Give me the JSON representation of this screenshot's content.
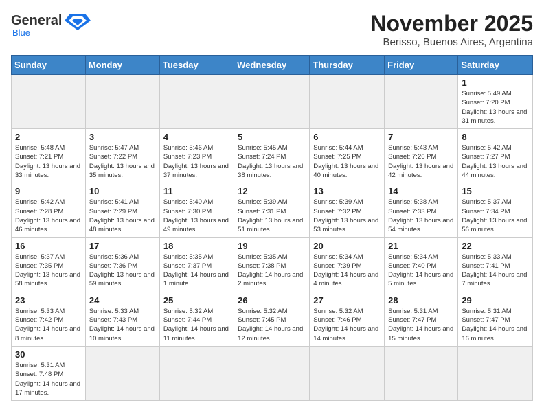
{
  "header": {
    "logo_general": "General",
    "logo_blue": "Blue",
    "month_title": "November 2025",
    "location": "Berisso, Buenos Aires, Argentina"
  },
  "weekdays": [
    "Sunday",
    "Monday",
    "Tuesday",
    "Wednesday",
    "Thursday",
    "Friday",
    "Saturday"
  ],
  "weeks": [
    [
      {
        "day": "",
        "info": ""
      },
      {
        "day": "",
        "info": ""
      },
      {
        "day": "",
        "info": ""
      },
      {
        "day": "",
        "info": ""
      },
      {
        "day": "",
        "info": ""
      },
      {
        "day": "",
        "info": ""
      },
      {
        "day": "1",
        "info": "Sunrise: 5:49 AM\nSunset: 7:20 PM\nDaylight: 13 hours and 31 minutes."
      }
    ],
    [
      {
        "day": "2",
        "info": "Sunrise: 5:48 AM\nSunset: 7:21 PM\nDaylight: 13 hours and 33 minutes."
      },
      {
        "day": "3",
        "info": "Sunrise: 5:47 AM\nSunset: 7:22 PM\nDaylight: 13 hours and 35 minutes."
      },
      {
        "day": "4",
        "info": "Sunrise: 5:46 AM\nSunset: 7:23 PM\nDaylight: 13 hours and 37 minutes."
      },
      {
        "day": "5",
        "info": "Sunrise: 5:45 AM\nSunset: 7:24 PM\nDaylight: 13 hours and 38 minutes."
      },
      {
        "day": "6",
        "info": "Sunrise: 5:44 AM\nSunset: 7:25 PM\nDaylight: 13 hours and 40 minutes."
      },
      {
        "day": "7",
        "info": "Sunrise: 5:43 AM\nSunset: 7:26 PM\nDaylight: 13 hours and 42 minutes."
      },
      {
        "day": "8",
        "info": "Sunrise: 5:42 AM\nSunset: 7:27 PM\nDaylight: 13 hours and 44 minutes."
      }
    ],
    [
      {
        "day": "9",
        "info": "Sunrise: 5:42 AM\nSunset: 7:28 PM\nDaylight: 13 hours and 46 minutes."
      },
      {
        "day": "10",
        "info": "Sunrise: 5:41 AM\nSunset: 7:29 PM\nDaylight: 13 hours and 48 minutes."
      },
      {
        "day": "11",
        "info": "Sunrise: 5:40 AM\nSunset: 7:30 PM\nDaylight: 13 hours and 49 minutes."
      },
      {
        "day": "12",
        "info": "Sunrise: 5:39 AM\nSunset: 7:31 PM\nDaylight: 13 hours and 51 minutes."
      },
      {
        "day": "13",
        "info": "Sunrise: 5:39 AM\nSunset: 7:32 PM\nDaylight: 13 hours and 53 minutes."
      },
      {
        "day": "14",
        "info": "Sunrise: 5:38 AM\nSunset: 7:33 PM\nDaylight: 13 hours and 54 minutes."
      },
      {
        "day": "15",
        "info": "Sunrise: 5:37 AM\nSunset: 7:34 PM\nDaylight: 13 hours and 56 minutes."
      }
    ],
    [
      {
        "day": "16",
        "info": "Sunrise: 5:37 AM\nSunset: 7:35 PM\nDaylight: 13 hours and 58 minutes."
      },
      {
        "day": "17",
        "info": "Sunrise: 5:36 AM\nSunset: 7:36 PM\nDaylight: 13 hours and 59 minutes."
      },
      {
        "day": "18",
        "info": "Sunrise: 5:35 AM\nSunset: 7:37 PM\nDaylight: 14 hours and 1 minute."
      },
      {
        "day": "19",
        "info": "Sunrise: 5:35 AM\nSunset: 7:38 PM\nDaylight: 14 hours and 2 minutes."
      },
      {
        "day": "20",
        "info": "Sunrise: 5:34 AM\nSunset: 7:39 PM\nDaylight: 14 hours and 4 minutes."
      },
      {
        "day": "21",
        "info": "Sunrise: 5:34 AM\nSunset: 7:40 PM\nDaylight: 14 hours and 5 minutes."
      },
      {
        "day": "22",
        "info": "Sunrise: 5:33 AM\nSunset: 7:41 PM\nDaylight: 14 hours and 7 minutes."
      }
    ],
    [
      {
        "day": "23",
        "info": "Sunrise: 5:33 AM\nSunset: 7:42 PM\nDaylight: 14 hours and 8 minutes."
      },
      {
        "day": "24",
        "info": "Sunrise: 5:33 AM\nSunset: 7:43 PM\nDaylight: 14 hours and 10 minutes."
      },
      {
        "day": "25",
        "info": "Sunrise: 5:32 AM\nSunset: 7:44 PM\nDaylight: 14 hours and 11 minutes."
      },
      {
        "day": "26",
        "info": "Sunrise: 5:32 AM\nSunset: 7:45 PM\nDaylight: 14 hours and 12 minutes."
      },
      {
        "day": "27",
        "info": "Sunrise: 5:32 AM\nSunset: 7:46 PM\nDaylight: 14 hours and 14 minutes."
      },
      {
        "day": "28",
        "info": "Sunrise: 5:31 AM\nSunset: 7:47 PM\nDaylight: 14 hours and 15 minutes."
      },
      {
        "day": "29",
        "info": "Sunrise: 5:31 AM\nSunset: 7:47 PM\nDaylight: 14 hours and 16 minutes."
      }
    ],
    [
      {
        "day": "30",
        "info": "Sunrise: 5:31 AM\nSunset: 7:48 PM\nDaylight: 14 hours and 17 minutes."
      },
      {
        "day": "",
        "info": ""
      },
      {
        "day": "",
        "info": ""
      },
      {
        "day": "",
        "info": ""
      },
      {
        "day": "",
        "info": ""
      },
      {
        "day": "",
        "info": ""
      },
      {
        "day": "",
        "info": ""
      }
    ]
  ]
}
